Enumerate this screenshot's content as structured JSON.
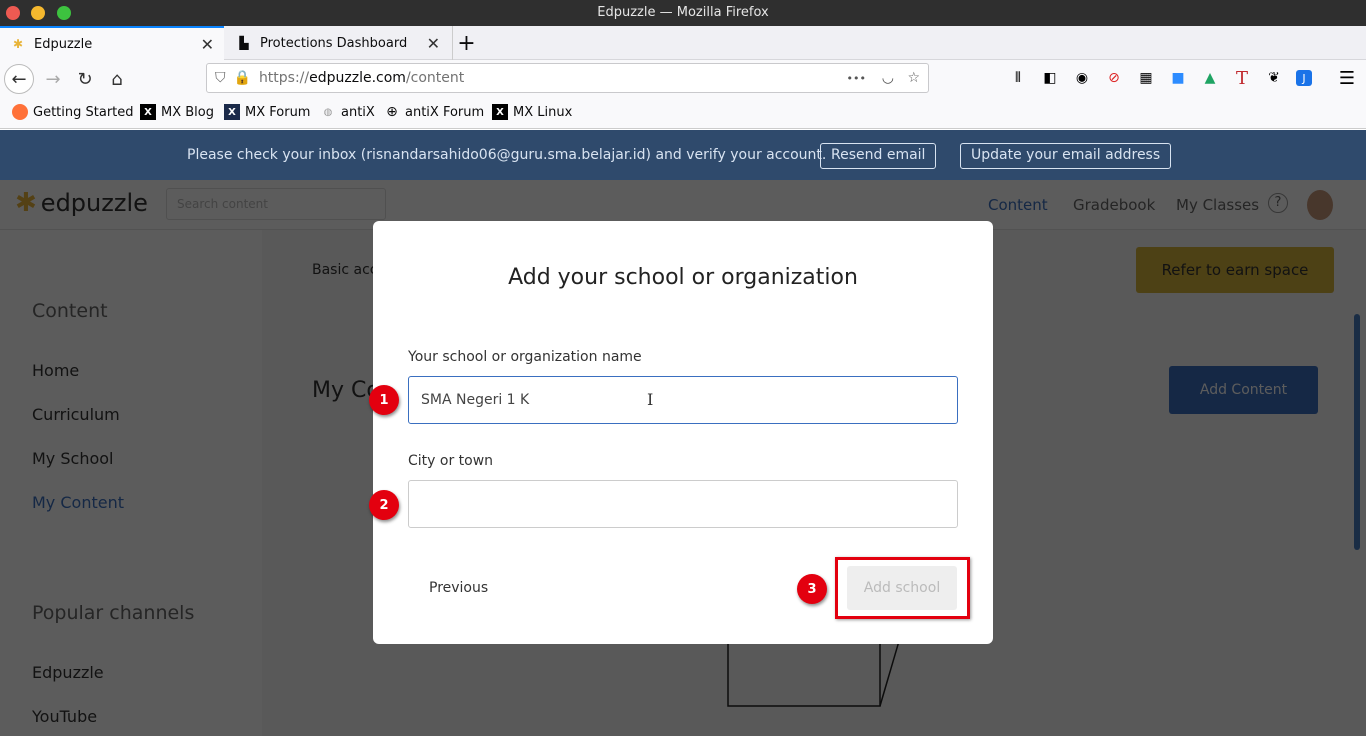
{
  "window": {
    "title": "Edpuzzle — Mozilla Firefox"
  },
  "tabs": [
    {
      "label": "Edpuzzle",
      "icon": "edpuzzle-favicon",
      "active": true
    },
    {
      "label": "Protections Dashboard",
      "icon": "chart-bars-icon",
      "active": false
    }
  ],
  "navbar": {
    "url_prefix": "https://",
    "url_host": "edpuzzle.com",
    "url_path": "/content",
    "more_label": "•••"
  },
  "bookmarks": [
    {
      "label": "Getting Started",
      "icon": "firefox-icon"
    },
    {
      "label": "MX Blog",
      "icon": "mx-icon"
    },
    {
      "label": "MX Forum",
      "icon": "mx-icon"
    },
    {
      "label": "antiX",
      "icon": "antix-icon"
    },
    {
      "label": "antiX Forum",
      "icon": "globe-icon"
    },
    {
      "label": "MX Linux",
      "icon": "mx-icon"
    }
  ],
  "banner": {
    "message": "Please check your inbox (risnandarsahido06@guru.sma.belajar.id) and verify your account.",
    "resend_label": "Resend email",
    "update_label": "Update your email address"
  },
  "app": {
    "logo_text": "edpuzzle",
    "search_placeholder": "Search content",
    "nav": {
      "content": "Content",
      "gradebook": "Gradebook",
      "classes": "My Classes",
      "help": "?"
    },
    "sidebar": {
      "heading": "Content",
      "items": [
        "Home",
        "Curriculum",
        "My School",
        "My Content"
      ],
      "active_item": "My Content",
      "popular_heading": "Popular channels",
      "channels": [
        "Edpuzzle",
        "YouTube"
      ]
    },
    "main": {
      "basic_account": "Basic account",
      "refer_label": "Refer to earn space",
      "section_title": "My Content",
      "add_content_label": "Add Content"
    }
  },
  "modal": {
    "title": "Add your school or organization",
    "school_label": "Your school or organization name",
    "school_value": "SMA Negeri 1 K",
    "city_label": "City or town",
    "city_value": "",
    "previous_label": "Previous",
    "add_school_label": "Add school"
  },
  "annotations": {
    "badge1": "1",
    "badge2": "2",
    "badge3": "3"
  },
  "colors": {
    "accent": "#3a6fc0",
    "banner": "#2f4a6c",
    "refer": "#d6b33a",
    "annotation": "#e3000f"
  }
}
